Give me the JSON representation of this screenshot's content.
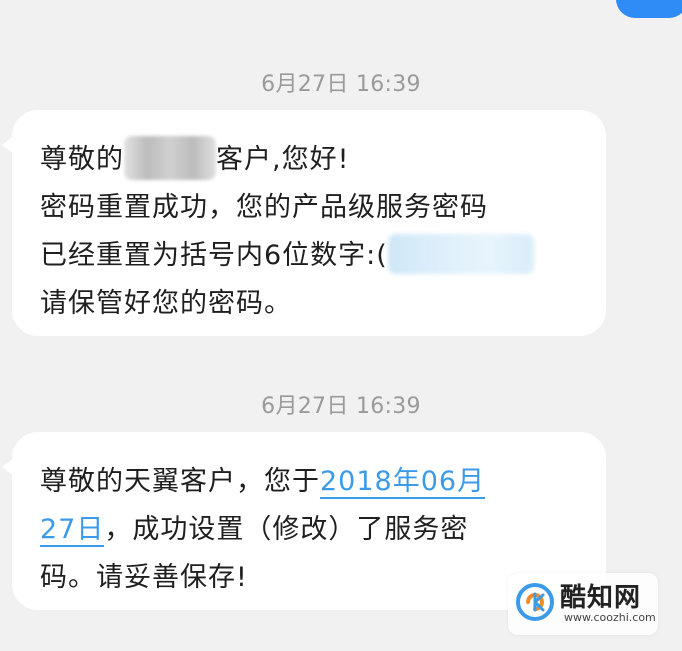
{
  "messages": [
    {
      "timestamp": "6月27日 16:39",
      "lines": {
        "l1_a": "尊敬",
        "l1_b": "的",
        "l1_c": "客户,您好!",
        "l2": "密码重置成功，您的产品级服务密码",
        "l3_a": "已经重置为括号内6位数字:",
        "l3_b": "(",
        "l4": "请保管好您的密码。"
      }
    },
    {
      "timestamp": "6月27日 16:39",
      "lines": {
        "l1_a": "尊敬的天翼客户，您于",
        "l1_link": "2018年06月",
        "l2_link": "27日",
        "l2_b": "，成功设置（修改）了服务密",
        "l3": "码。请妥善保存!"
      }
    }
  ],
  "watermark": {
    "name": "酷知网",
    "url": "www.coozhi.com"
  },
  "colors": {
    "background": "#f1f1f1",
    "bubble": "#ffffff",
    "link": "#3b9be8",
    "timestamp": "#9a9a9a",
    "sent_bubble": "#2f8cf6"
  }
}
